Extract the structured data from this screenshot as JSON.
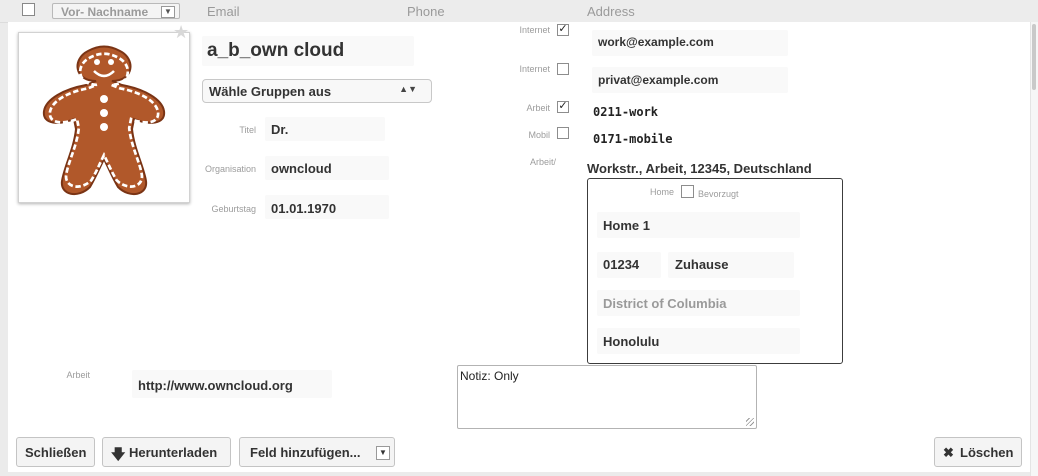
{
  "header": {
    "name_sort_label": "Vor- Nachname",
    "columns": [
      "Email",
      "Phone",
      "Address"
    ]
  },
  "contact": {
    "full_name": "a_b_own cloud",
    "groups_select": "Wähle Gruppen aus",
    "title_label": "Titel",
    "title_value": "Dr.",
    "org_label": "Organisation",
    "org_value": "owncloud",
    "birthday_label": "Geburtstag",
    "birthday_value": "01.01.1970",
    "emails": [
      {
        "type": "Internet",
        "preferred": true,
        "value": "work@example.com"
      },
      {
        "type": "Internet",
        "preferred": false,
        "value": "privat@example.com"
      }
    ],
    "phones": [
      {
        "type": "Arbeit",
        "preferred": true,
        "value": "0211-work"
      },
      {
        "type": "Mobil",
        "preferred": false,
        "value": "0171-mobile"
      }
    ],
    "address_type_label": "Arbeit/",
    "address_summary": "Workstr., Arbeit, 12345, Deutschland",
    "address_box": {
      "type_label": "Home",
      "preferred_label": "Bevorzugt",
      "street": "Home 1",
      "zip": "01234",
      "city": "Zuhause",
      "region": "District of Columbia",
      "country": "Honolulu"
    },
    "url_label": "Arbeit",
    "url_value": "http://www.owncloud.org",
    "notes": "Notiz: Only"
  },
  "buttons": {
    "close": "Schließen",
    "download": "Herunterladen",
    "add_field": "Feld hinzufügen...",
    "delete": "Löschen"
  }
}
